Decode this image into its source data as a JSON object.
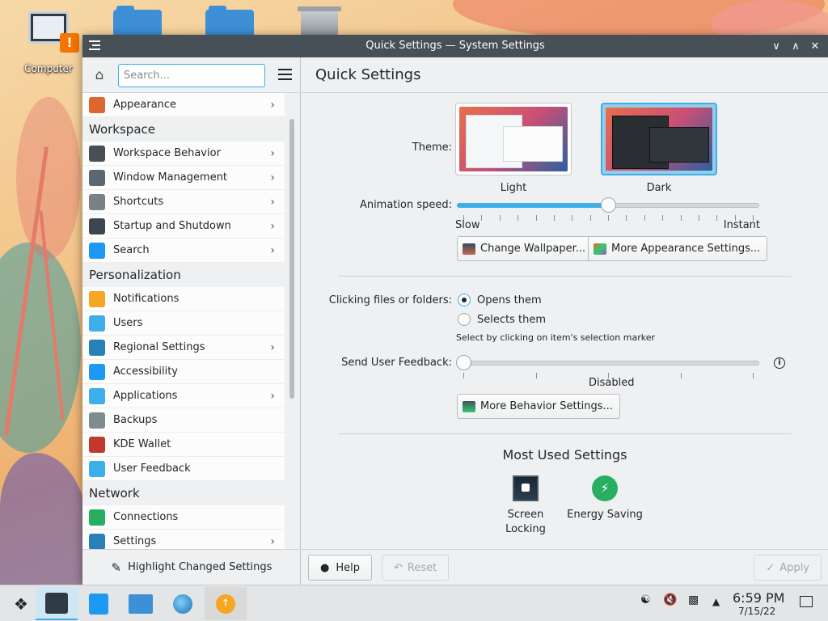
{
  "desktop": {
    "computer_label": "Computer"
  },
  "window": {
    "title": "Quick Settings — System Settings",
    "controls": [
      "minimize",
      "maximize",
      "close"
    ]
  },
  "sidebar": {
    "search_placeholder": "Search...",
    "items": [
      {
        "label": "Appearance",
        "chevron": true,
        "icon": "appearance-icon",
        "color": "#e0662f"
      },
      {
        "category": "Workspace"
      },
      {
        "label": "Workspace Behavior",
        "chevron": true,
        "icon": "workspace-behavior-icon",
        "color": "#475057"
      },
      {
        "label": "Window Management",
        "chevron": true,
        "icon": "window-management-icon",
        "color": "#5c6670"
      },
      {
        "label": "Shortcuts",
        "chevron": true,
        "icon": "keyboard-icon",
        "color": "#7a8087"
      },
      {
        "label": "Startup and Shutdown",
        "chevron": true,
        "icon": "startup-icon",
        "color": "#3b4650"
      },
      {
        "label": "Search",
        "chevron": true,
        "icon": "search-icon",
        "color": "#1d99f3"
      },
      {
        "category": "Personalization"
      },
      {
        "label": "Notifications",
        "chevron": false,
        "icon": "bell-icon",
        "color": "#f6a623"
      },
      {
        "label": "Users",
        "chevron": false,
        "icon": "users-icon",
        "color": "#3daee9"
      },
      {
        "label": "Regional Settings",
        "chevron": true,
        "icon": "regional-flag-icon",
        "color": "#2980b9"
      },
      {
        "label": "Accessibility",
        "chevron": false,
        "icon": "accessibility-icon",
        "color": "#1d99f3"
      },
      {
        "label": "Applications",
        "chevron": true,
        "icon": "applications-grid-icon",
        "color": "#3daee9"
      },
      {
        "label": "Backups",
        "chevron": false,
        "icon": "backup-clock-icon",
        "color": "#7f8c8d"
      },
      {
        "label": "KDE Wallet",
        "chevron": false,
        "icon": "wallet-icon",
        "color": "#c0392b"
      },
      {
        "label": "User Feedback",
        "chevron": false,
        "icon": "feedback-bubble-icon",
        "color": "#3daee9"
      },
      {
        "category": "Network"
      },
      {
        "label": "Connections",
        "chevron": false,
        "icon": "globe-icon",
        "color": "#27ae60"
      },
      {
        "label": "Settings",
        "chevron": true,
        "icon": "network-settings-globe-icon",
        "color": "#2980b9"
      }
    ],
    "footer_label": "Highlight Changed Settings"
  },
  "main": {
    "header": "Quick Settings",
    "theme_label": "Theme:",
    "themes": [
      {
        "name": "Light",
        "selected": false
      },
      {
        "name": "Dark",
        "selected": true
      }
    ],
    "animation_label": "Animation speed:",
    "animation_min": "Slow",
    "animation_max": "Instant",
    "animation_value": 0.5,
    "change_wallpaper": "Change Wallpaper...",
    "more_appearance": "More Appearance Settings...",
    "clicking_label": "Clicking files or folders:",
    "click_options": [
      {
        "label": "Opens them",
        "selected": true
      },
      {
        "label": "Selects them",
        "selected": false
      }
    ],
    "select_hint": "Select by clicking on item's selection marker",
    "feedback_label": "Send User Feedback:",
    "feedback_value_text": "Disabled",
    "feedback_value": 0,
    "more_behavior": "More Behavior Settings...",
    "most_used_title": "Most Used Settings",
    "most_used": [
      {
        "label": "Screen\nLocking",
        "icon": "screen-locking-icon"
      },
      {
        "label": "Energy Saving",
        "icon": "energy-saving-icon"
      }
    ],
    "footer": {
      "help": "Help",
      "reset": "Reset",
      "apply": "Apply"
    }
  },
  "taskbar": {
    "time": "6:59 PM",
    "date": "7/15/22"
  }
}
